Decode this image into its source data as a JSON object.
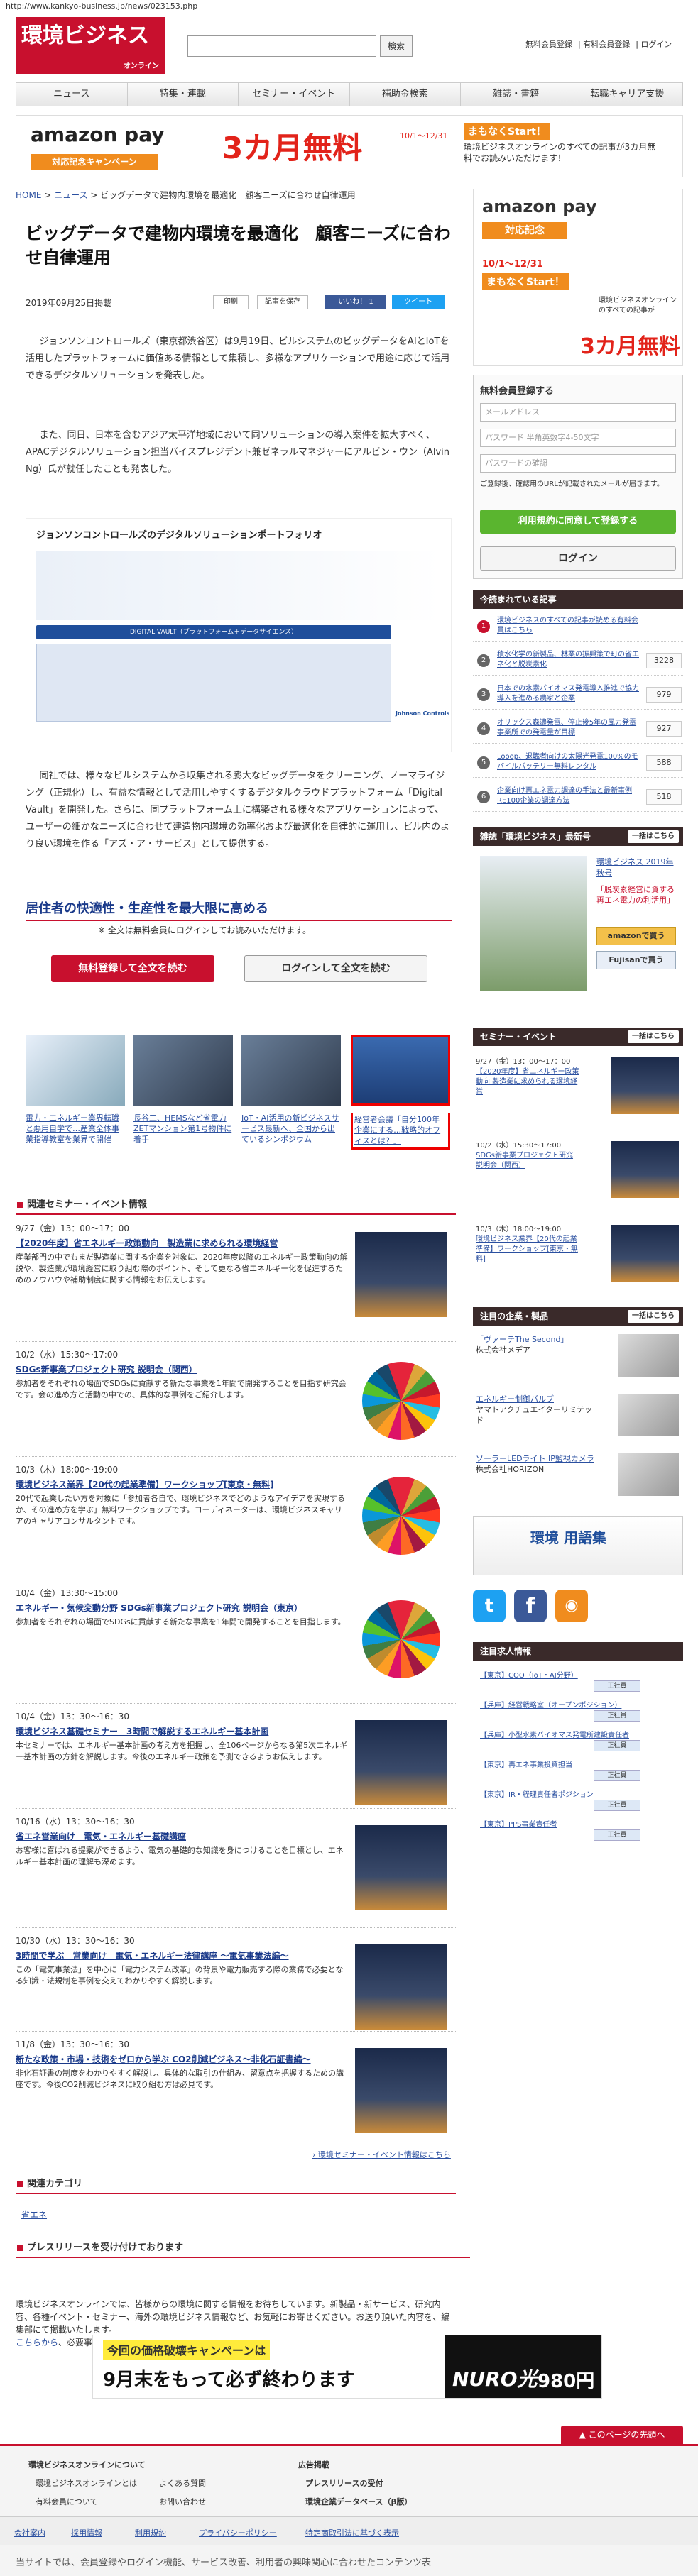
{
  "url": "http://www.kankyo-business.jp/news/023153.php",
  "logo": {
    "text": "環境ビジネス",
    "sub": "オンライン"
  },
  "search": {
    "placeholder": "",
    "button": "検索"
  },
  "top_links": [
    "無料会員登録",
    "有料会員登録",
    "ログイン"
  ],
  "nav": [
    "ニュース",
    "特集・連載",
    "セミナー・イベント",
    "補助金検索",
    "雑誌・書籍",
    "転職キャリア支援"
  ],
  "top_banner": {
    "brand": "amazon pay",
    "campaign": "対応記念キャンペーン",
    "big": "3カ月無料",
    "note": "10/1〜12/31",
    "right_title": "まもなくStart！",
    "right_text": "環境ビジネスオンラインのすべての記事が3カ月無料でお読みいただけます！"
  },
  "breadcrumb": [
    "HOME",
    "ニュース",
    "ビッグデータで建物内環境を最適化　顧客ニーズに合わせ自律運用"
  ],
  "article": {
    "title": "ビッグデータで建物内環境を最適化　顧客ニーズに合わせ自律運用",
    "date": "2019年09月25日掲載",
    "share": [
      "印刷",
      "記事を保存",
      "いいね！ 1",
      "ツイート"
    ],
    "p1": "ジョンソンコントロールズ（東京都渋谷区）は9月19日、ビルシステムのビッグデータをAIとIoTを活用したプラットフォームに価値ある情報として集積し、多様なアプリケーションで用途に応じて活用できるデジタルソリューションを発表した。",
    "p2": "また、同日、日本を含むアジア太平洋地域において同ソリューションの導入案件を拡大すべく、APACデジタルソリューション担当バイスプレジデント兼ゼネラルマネジャーにアルビン・ウン（Alvin Ng）氏が就任したことも発表した。",
    "figure_title": "ジョンソンコントロールズのデジタルソリューションポートフォリオ",
    "figure_band": "DIGITAL VAULT（プラットフォーム＋データサイエンス）",
    "figure_brand": "Johnson Controls",
    "p3": "同社では、様々なビルシステムから収集される膨大なビッグデータをクリーニング、ノーマライジング（正規化）し、有益な情報として活用しやすくするデジタルクラウドプラットフォーム「Digital Vault」を開発した。さらに、同プラットフォーム上に構築される様々なアプリケーションによって、ユーザーの細かなニーズに合わせて建造物内環境の効率化および最適化を自律的に運用し、ビル内のより良い環境を作る「アズ・ア・サービス」として提供する。",
    "readmore_heading": "居住者の快適性・生産性を最大限に高める",
    "members_note": "※ 全文は無料会員にログインしてお読みいただけます。",
    "register_button": "無料登録して全文を読む",
    "login_button": "ログインして全文を読む"
  },
  "related_thumbs": [
    "電力・エネルギー業界転職と悪用自学で…産業全体事業指導教室を業界で開催",
    "長谷工、HEMSなど省電力ZETマンション第1号物件に着手",
    "IoT・AI活用の新ビジネスサービス最新へ、全国から出ているシンポジウム",
    "経営者会議「自分100年企業にする…戦略的オフィスとは？」"
  ],
  "events_section": "関連セミナー・イベント情報",
  "events": [
    {
      "date": "9/27（金）13：00〜17：00",
      "title": "【2020年度】省エネルギー政策動向　製造業に求められる環境経営",
      "desc": "産業部門の中でもまだ製造業に関する企業を対象に、2020年度以降のエネルギー政策動向の解説や、製造業が環境経営に取り組む際のポイント、そして更なる省エネルギー化を促進するためのノウハウや補助制度に関する情報をお伝えします。",
      "img": "plant"
    },
    {
      "date": "10/2（水）15:30〜17:00",
      "title": "SDGs新事業プロジェクト研究 説明会（関西）",
      "desc": "参加者をそれぞれの場面でSDGsに貢献する新たな事業を1年間で開発することを目指す研究会です。会の進め方と活動の中での、具体的な事例をご紹介します。",
      "img": "sdg"
    },
    {
      "date": "10/3（木）18:00〜19:00",
      "title": "環境ビジネス業界【20代の起業準備】ワークショップ[東京・無料]",
      "desc": "20代で起業したい方を対象に「参加者各自で、環境ビジネスでどのようなアイデアを実現するか、その進め方を学ぶ」無料ワークショップです。コーディネーターは、環境ビジネスキャリアのキャリアコンサルタントです。",
      "img": "sdg"
    },
    {
      "date": "10/4（金）13:30〜15:00",
      "title": "エネルギー・気候変動分野 SDGs新事業プロジェクト研究 説明会（東京）",
      "desc": "参加者をそれぞれの場面でSDGsに貢献する新たな事業を1年間で開発することを目指します。",
      "img": "sdg"
    },
    {
      "date": "10/4（金）13：30〜16：30",
      "title": "環境ビジネス基礎セミナー　3時間で解説するエネルギー基本計画",
      "desc": "本セミナーでは、エネルギー基本計画の考え方を把握し、全106ページからなる第5次エネルギー基本計画の方針を解説します。今後のエネルギー政策を予測できるようお伝えします。",
      "img": "plant"
    },
    {
      "date": "10/16（水）13：30〜16：30",
      "title": "省エネ営業向け　電気・エネルギー基礎講座",
      "desc": "お客様に喜ばれる提案ができるよう、電気の基礎的な知識を身につけることを目標とし、エネルギー基本計画の理解も深めます。",
      "img": "plant"
    },
    {
      "date": "10/30（水）13：30〜16：30",
      "title": "3時間で学ぶ　営業向け　電気・エネルギー法律講座 〜電気事業法編〜",
      "desc": "この「電気事業法」を中心に「電力システム改革」の背景や電力販売する際の業務で必要となる知識・法規制を事例を交えてわかりやすく解説します。",
      "img": "plant"
    },
    {
      "date": "11/8（金）13：30〜16：30",
      "title": "新たな政策・市場・技術をゼロから学ぶ CO2削減ビジネス〜非化石証書編〜",
      "desc": "非化石証書の制度をわかりやすく解説し、具体的な取引の仕組み、留意点を把握するための講座です。今後CO2削減ビジネスに取り組む方は必見です。",
      "img": "plant"
    }
  ],
  "events_more": "環境セミナー・イベント情報はこちら",
  "category_section": "関連カテゴリ",
  "category": "省エネ",
  "press_section": "プレスリリースを受け付けております",
  "press_text": "環境ビジネスオンラインでは、皆様からの環境に関する情報をお待ちしています。新製品・新サービス、研究内容、各種イベント・セミナー、海外の環境ビジネス情報など、お気軽にお寄せください。お送り頂いた内容を、編集部にて掲載いたします。",
  "press_link": "こちらから",
  "press_link_after": "、必要事項をご記入ください",
  "footer_banner": {
    "text": "今回の価格破壊キャンペーンは",
    "big": "9月末をもって必ず終わります",
    "right": "NURO光",
    "price": "980円"
  },
  "pagetop": "このページの先頭へ",
  "footer_cols": [
    {
      "head": "環境ビジネスオンラインについて",
      "items": [
        "環境ビジネスオンラインとは",
        "有料会員について"
      ]
    },
    {
      "head": "",
      "items": [
        "よくある質問",
        "お問い合わせ"
      ]
    },
    {
      "head": "広告掲載",
      "items": [
        "プレスリリースの受付",
        "環境企業データベース（β版）"
      ]
    }
  ],
  "footer_links": [
    "会社案内",
    "採用情報",
    "利用規約",
    "プライバシーポリシー",
    "特定商取引法に基づく表示"
  ],
  "copy_note": "当サイトでは、会員登録やログイン機能、サービス改善、利用者の興味関心に合わせたコンテンツ表",
  "sidebar": {
    "banner": {
      "brand": "amazon pay",
      "sub": "対応記念",
      "date": "10/1〜12/31",
      "start": "まもなくStart！",
      "text": "環境ビジネスオンラインのすべての記事が",
      "big": "3カ月無料"
    },
    "register_title": "無料会員登録する",
    "email_ph": "メールアドレス",
    "password_ph": "パスワード 半角英数字4-50文字",
    "confirm_ph": "パスワードの確認",
    "terms": "ご登録後、確認用のURLが記載されたメールが届きます。",
    "register_btn": "利用規約に同意して登録する",
    "login_btn": "ログイン",
    "ranking_head": "今読まれている記事",
    "ranking": [
      {
        "n": "1",
        "t": "環境ビジネスのすべての記事が読める有料会員はこちら",
        "c": ""
      },
      {
        "n": "2",
        "t": "積水化学の新製品、林業の振興策で町の省エネ化と脱炭素化",
        "c": "3228"
      },
      {
        "n": "3",
        "t": "日本での水素バイオマス発電導入推進で協力 導入を進める農家と企業",
        "c": "979"
      },
      {
        "n": "4",
        "t": "オリックス森濃発電、停止後5年の風力発電事業所での発電量が目標",
        "c": "927"
      },
      {
        "n": "5",
        "t": "Looop、退職者向けの太陽光発電100%のモバイルバッテリー無料レンタル",
        "c": "588"
      },
      {
        "n": "6",
        "t": "企業向け再エネ電力調達の手法と最新事例 RE100企業の調達方法",
        "c": "518"
      }
    ],
    "magazine_head": "雑誌「環境ビジネス」最新号",
    "magazine_more": "一括はこちら",
    "magazine_title": "環境ビジネス 2019年 秋号",
    "magazine_sub": "「脱炭素経営に資する再エネ電力の利活用」",
    "amazon_btn": "amazonで買う",
    "fujisan_btn": "Fujisanで買う",
    "seminar_head": "セミナー・イベント",
    "seminar_more": "一括はこちら",
    "seminars": [
      {
        "date": "9/27（金）13：00〜17：00",
        "t": "【2020年度】省エネルギー政策動向 製造業に求められる環境経営"
      },
      {
        "date": "10/2（水）15:30〜17:00",
        "t": "SDGs新事業プロジェクト研究 説明会（関西）"
      },
      {
        "date": "10/3（木）18:00〜19:00",
        "t": "環境ビジネス業界【20代の起業準備】ワークショップ[東京・無料]"
      }
    ],
    "product_head": "注目の企業・製品",
    "product_more": "一括はこちら",
    "products": [
      {
        "t": "「ヴァーテThe Second」",
        "co": "株式会社メデア"
      },
      {
        "t": "エネルギー制御バルブ",
        "co": "ヤマトアクチュエイターリミテッド"
      },
      {
        "t": "ソーラーLEDライト IP監視カメラ",
        "co": "株式会社HORIZON"
      }
    ],
    "glossary": "環境 用語集",
    "social": [
      "twitter-icon",
      "facebook-icon",
      "rss-icon"
    ],
    "jobs_head": "注目求人情報",
    "jobs": [
      {
        "t": "【東京】COO（IoT・AI分野）",
        "co": "正社員"
      },
      {
        "t": "【兵庫】経営戦略室（オープンポジション）",
        "co": "正社員"
      },
      {
        "t": "【兵庫】小型水素バイオマス発電所建設責任者",
        "co": "正社員"
      },
      {
        "t": "【東京】再エネ事業投資担当",
        "co": "正社員"
      },
      {
        "t": "【東京】IR・経理責任者ポジション",
        "co": "正社員"
      },
      {
        "t": "【東京】PPS事業責任者",
        "co": "正社員"
      }
    ]
  }
}
